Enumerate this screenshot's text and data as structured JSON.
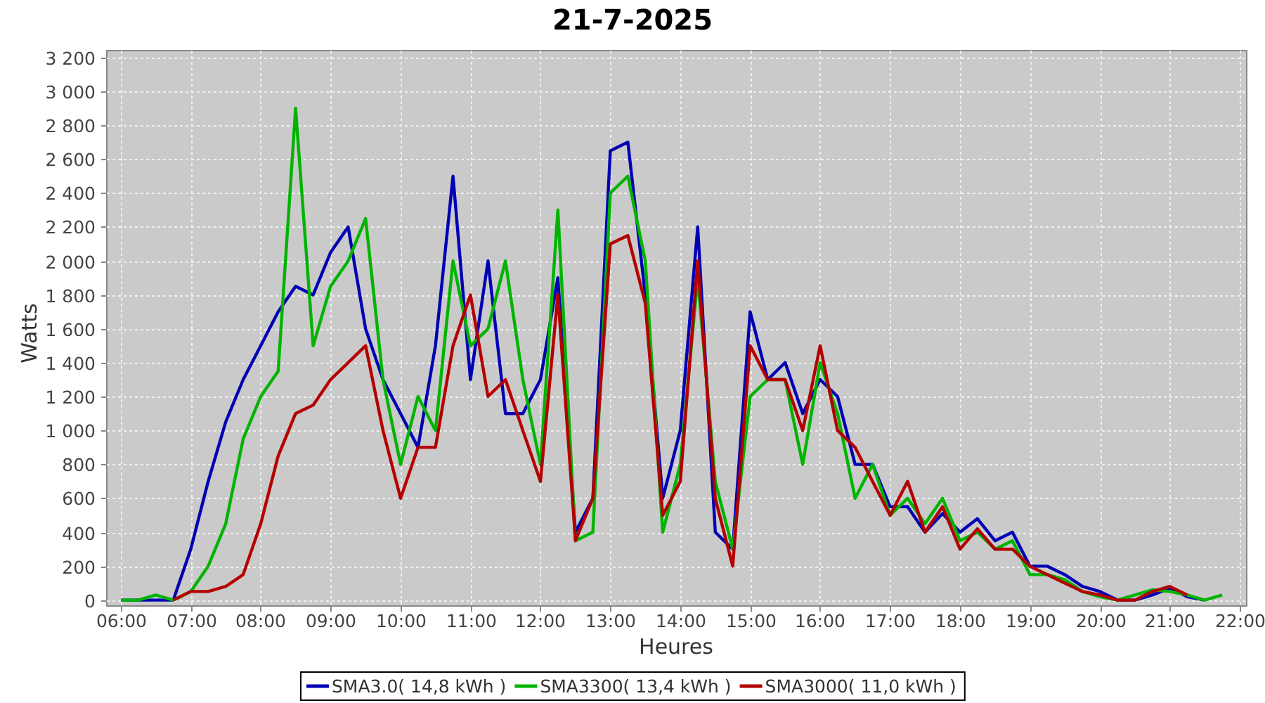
{
  "chart": {
    "chart_data": {
      "type": "line",
      "title": "21-7-2025",
      "xlabel": "Heures",
      "ylabel": "Watts",
      "x": [
        6,
        6.25,
        6.5,
        6.75,
        7,
        7.25,
        7.5,
        7.75,
        8,
        8.25,
        8.5,
        8.75,
        9,
        9.25,
        9.5,
        9.75,
        10,
        10.25,
        10.5,
        10.75,
        11,
        11.25,
        11.5,
        11.75,
        12,
        12.25,
        12.5,
        12.75,
        13,
        13.25,
        13.5,
        13.75,
        14,
        14.25,
        14.5,
        14.75,
        15,
        15.25,
        15.5,
        15.75,
        16,
        16.25,
        16.5,
        16.75,
        17,
        17.25,
        17.5,
        17.75,
        18,
        18.25,
        18.5,
        18.75,
        19,
        19.25,
        19.5,
        19.75,
        20,
        20.25,
        20.5,
        20.75,
        21,
        21.25,
        21.5,
        21.75
      ],
      "series": [
        {
          "name": "SMA3.0( 14,8 kWh )",
          "color": "#0000b4",
          "values": [
            0,
            0,
            0,
            0,
            300,
            700,
            1050,
            1300,
            1500,
            1700,
            1850,
            1800,
            2050,
            2200,
            1600,
            1300,
            1100,
            900,
            1500,
            2500,
            1300,
            2000,
            1100,
            1100,
            1300,
            1900,
            400,
            600,
            2650,
            2700,
            1800,
            600,
            1000,
            2200,
            400,
            300,
            1700,
            1300,
            1400,
            1100,
            1300,
            1200,
            800,
            800,
            550,
            550,
            400,
            510,
            400,
            480,
            350,
            400,
            200,
            200,
            150,
            80,
            50,
            0,
            0,
            30,
            70,
            20,
            0,
            null
          ]
        },
        {
          "name": "SMA3300( 13,4 kWh )",
          "color": "#00b400",
          "values": [
            0,
            0,
            30,
            0,
            50,
            200,
            450,
            950,
            1200,
            1350,
            2900,
            1500,
            1850,
            2000,
            2250,
            1300,
            800,
            1200,
            1000,
            2000,
            1500,
            1600,
            2000,
            1300,
            800,
            2300,
            350,
            400,
            2400,
            2500,
            2000,
            400,
            800,
            1900,
            700,
            300,
            1200,
            1300,
            1300,
            800,
            1400,
            1100,
            600,
            800,
            500,
            600,
            450,
            600,
            350,
            400,
            300,
            350,
            150,
            150,
            120,
            50,
            20,
            0,
            30,
            60,
            50,
            30,
            0,
            30
          ]
        },
        {
          "name": "SMA3000( 11,0 kWh )",
          "color": "#b40000",
          "values": [
            null,
            null,
            null,
            0,
            50,
            50,
            80,
            150,
            450,
            850,
            1100,
            1150,
            1300,
            1400,
            1500,
            1000,
            600,
            900,
            900,
            1500,
            1800,
            1200,
            1300,
            1000,
            700,
            1800,
            350,
            600,
            2100,
            2150,
            1750,
            500,
            700,
            2000,
            600,
            200,
            1500,
            1300,
            1300,
            1000,
            1500,
            1000,
            900,
            700,
            500,
            700,
            400,
            550,
            300,
            420,
            300,
            300,
            200,
            150,
            100,
            50,
            30,
            0,
            0,
            50,
            80,
            30,
            null,
            null
          ]
        }
      ],
      "grid": true,
      "legend": "bottom",
      "xlim": [
        5.8,
        22.1
      ],
      "ylim": [
        -35,
        3240
      ],
      "xticks": [
        {
          "value": 6,
          "label": "06:00"
        },
        {
          "value": 7,
          "label": "07:00"
        },
        {
          "value": 8,
          "label": "08:00"
        },
        {
          "value": 9,
          "label": "09:00"
        },
        {
          "value": 10,
          "label": "10:00"
        },
        {
          "value": 11,
          "label": "11:00"
        },
        {
          "value": 12,
          "label": "12:00"
        },
        {
          "value": 13,
          "label": "13:00"
        },
        {
          "value": 14,
          "label": "14:00"
        },
        {
          "value": 15,
          "label": "15:00"
        },
        {
          "value": 16,
          "label": "16:00"
        },
        {
          "value": 17,
          "label": "17:00"
        },
        {
          "value": 18,
          "label": "18:00"
        },
        {
          "value": 19,
          "label": "19:00"
        },
        {
          "value": 20,
          "label": "20:00"
        },
        {
          "value": 21,
          "label": "21:00"
        },
        {
          "value": 22,
          "label": "22:00"
        }
      ],
      "yticks": [
        {
          "value": 0,
          "label": "0"
        },
        {
          "value": 200,
          "label": "200"
        },
        {
          "value": 400,
          "label": "400"
        },
        {
          "value": 600,
          "label": "600"
        },
        {
          "value": 800,
          "label": "800"
        },
        {
          "value": 1000,
          "label": "1 000"
        },
        {
          "value": 1200,
          "label": "1 200"
        },
        {
          "value": 1400,
          "label": "1 400"
        },
        {
          "value": 1600,
          "label": "1 600"
        },
        {
          "value": 1800,
          "label": "1 800"
        },
        {
          "value": 2000,
          "label": "2 000"
        },
        {
          "value": 2200,
          "label": "2 200"
        },
        {
          "value": 2400,
          "label": "2 400"
        },
        {
          "value": 2600,
          "label": "2 600"
        },
        {
          "value": 2800,
          "label": "2 800"
        },
        {
          "value": 3000,
          "label": "3 000"
        },
        {
          "value": 3200,
          "label": "3 200"
        }
      ]
    }
  }
}
